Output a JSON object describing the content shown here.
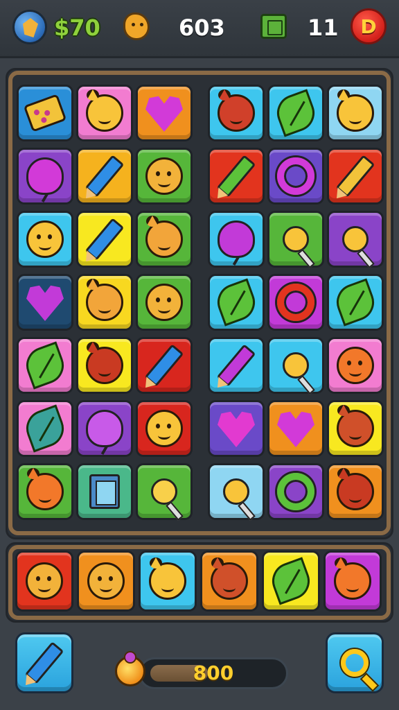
{
  "header": {
    "money": "$70",
    "score": "603",
    "level": "11",
    "d_button": "D"
  },
  "board": {
    "left": [
      [
        {
          "bg": "#2a8fd8",
          "glyph": "card-icon",
          "fg": "#f2c33a"
        },
        {
          "bg": "#f27cd0",
          "glyph": "cat-face-icon",
          "fg": "#f8c43a"
        },
        {
          "bg": "#f0901e",
          "glyph": "heart-icon",
          "fg": "#d23ad8"
        }
      ],
      [
        {
          "bg": "#8a44c8",
          "glyph": "balloon-icon",
          "fg": "#d23ad8"
        },
        {
          "bg": "#f5b21e",
          "glyph": "pencil-icon",
          "fg": "#2f8ee6"
        },
        {
          "bg": "#56b63a",
          "glyph": "face-icon",
          "fg": "#f2b23a"
        }
      ],
      [
        {
          "bg": "#3ec6ee",
          "glyph": "sun-face-icon",
          "fg": "#f8c43a"
        },
        {
          "bg": "#f8e820",
          "glyph": "pencil-icon",
          "fg": "#2f8ee6"
        },
        {
          "bg": "#56b63a",
          "glyph": "cat-face-icon",
          "fg": "#f2a53a"
        }
      ],
      [
        {
          "bg": "#1f4a70",
          "glyph": "heart-icon",
          "fg": "#c23ad8"
        },
        {
          "bg": "#f8d820",
          "glyph": "cat-face-icon",
          "fg": "#f2a53a"
        },
        {
          "bg": "#56b63a",
          "glyph": "face-icon",
          "fg": "#f2b23a"
        }
      ],
      [
        {
          "bg": "#f27cd0",
          "glyph": "leaf-icon",
          "fg": "#5cc23a"
        },
        {
          "bg": "#f8e820",
          "glyph": "cat-face-icon",
          "fg": "#c93a22"
        },
        {
          "bg": "#d8261e",
          "glyph": "pencil-icon",
          "fg": "#2f8ee6"
        }
      ],
      [
        {
          "bg": "#f27cd0",
          "glyph": "leaf-icon",
          "fg": "#3aa29a"
        },
        {
          "bg": "#8a44c8",
          "glyph": "balloon-icon",
          "fg": "#c85ae8"
        },
        {
          "bg": "#d8261e",
          "glyph": "face-icon",
          "fg": "#f8c43a"
        }
      ],
      [
        {
          "bg": "#56b63a",
          "glyph": "cat-face-icon",
          "fg": "#f2782a"
        },
        {
          "bg": "#4ab88a",
          "glyph": "book-icon",
          "fg": "#4a8ac8"
        },
        {
          "bg": "#56b63a",
          "glyph": "lollipop-icon",
          "fg": "#f8d04a"
        }
      ]
    ],
    "right": [
      [
        {
          "bg": "#3ec6ee",
          "glyph": "cat-face-icon",
          "fg": "#d0402a"
        },
        {
          "bg": "#3ec6ee",
          "glyph": "leaf-icon",
          "fg": "#5cc23a"
        },
        {
          "bg": "#8fd6f2",
          "glyph": "cat-face-icon",
          "fg": "#f8c43a"
        }
      ],
      [
        {
          "bg": "#e2341e",
          "glyph": "pencil-icon",
          "fg": "#5cc23a"
        },
        {
          "bg": "#6a4ac8",
          "glyph": "ring-icon",
          "fg": "#d23ad8"
        },
        {
          "bg": "#e2341e",
          "glyph": "pencil-icon",
          "fg": "#f2c33a"
        }
      ],
      [
        {
          "bg": "#3ec6ee",
          "glyph": "balloon-icon",
          "fg": "#c23ad8"
        },
        {
          "bg": "#56b63a",
          "glyph": "lollipop-icon",
          "fg": "#f8c43a"
        },
        {
          "bg": "#8a44c8",
          "glyph": "lollipop-icon",
          "fg": "#f8c43a"
        }
      ],
      [
        {
          "bg": "#3ec6ee",
          "glyph": "leaf-icon",
          "fg": "#5cc23a"
        },
        {
          "bg": "#c23ad8",
          "glyph": "ring-icon",
          "fg": "#e2341e"
        },
        {
          "bg": "#3ec6ee",
          "glyph": "leaf-icon",
          "fg": "#5cc23a"
        }
      ],
      [
        {
          "bg": "#3ec6ee",
          "glyph": "pencil-icon",
          "fg": "#c23ad8"
        },
        {
          "bg": "#3ec6ee",
          "glyph": "lollipop-icon",
          "fg": "#f8c43a"
        },
        {
          "bg": "#f27cd0",
          "glyph": "face-icon",
          "fg": "#f2782a"
        }
      ],
      [
        {
          "bg": "#6a4ac8",
          "glyph": "heart-icon",
          "fg": "#e23ad0"
        },
        {
          "bg": "#f0901e",
          "glyph": "heart-icon",
          "fg": "#d23ad8"
        },
        {
          "bg": "#f8e820",
          "glyph": "cat-face-icon",
          "fg": "#d0502a"
        }
      ],
      [
        {
          "bg": "#8fd6f2",
          "glyph": "lollipop-icon",
          "fg": "#f8c43a"
        },
        {
          "bg": "#8a44c8",
          "glyph": "ring-icon",
          "fg": "#5cc23a"
        },
        {
          "bg": "#f0901e",
          "glyph": "cat-face-icon",
          "fg": "#c93a22"
        }
      ]
    ]
  },
  "tray": [
    {
      "bg": "#e2341e",
      "glyph": "face-icon",
      "fg": "#f2b23a"
    },
    {
      "bg": "#f0901e",
      "glyph": "face-icon",
      "fg": "#f2b23a"
    },
    {
      "bg": "#3ec6ee",
      "glyph": "cat-face-icon",
      "fg": "#f8c43a"
    },
    {
      "bg": "#f0901e",
      "glyph": "cat-face-icon",
      "fg": "#d0502a"
    },
    {
      "bg": "#f8e820",
      "glyph": "leaf-icon",
      "fg": "#5cc23a"
    },
    {
      "bg": "#c23ad8",
      "glyph": "cat-face-icon",
      "fg": "#f2782a"
    }
  ],
  "footer": {
    "progress_value": "800",
    "progress_fraction": 0.45
  }
}
